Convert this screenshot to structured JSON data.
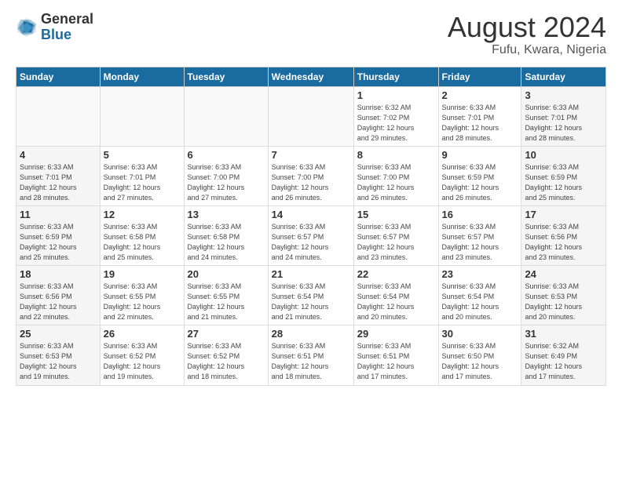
{
  "logo": {
    "general": "General",
    "blue": "Blue"
  },
  "header": {
    "month": "August 2024",
    "location": "Fufu, Kwara, Nigeria"
  },
  "weekdays": [
    "Sunday",
    "Monday",
    "Tuesday",
    "Wednesday",
    "Thursday",
    "Friday",
    "Saturday"
  ],
  "weeks": [
    [
      {
        "day": "",
        "info": ""
      },
      {
        "day": "",
        "info": ""
      },
      {
        "day": "",
        "info": ""
      },
      {
        "day": "",
        "info": ""
      },
      {
        "day": "1",
        "info": "Sunrise: 6:32 AM\nSunset: 7:02 PM\nDaylight: 12 hours\nand 29 minutes."
      },
      {
        "day": "2",
        "info": "Sunrise: 6:33 AM\nSunset: 7:01 PM\nDaylight: 12 hours\nand 28 minutes."
      },
      {
        "day": "3",
        "info": "Sunrise: 6:33 AM\nSunset: 7:01 PM\nDaylight: 12 hours\nand 28 minutes."
      }
    ],
    [
      {
        "day": "4",
        "info": "Sunrise: 6:33 AM\nSunset: 7:01 PM\nDaylight: 12 hours\nand 28 minutes."
      },
      {
        "day": "5",
        "info": "Sunrise: 6:33 AM\nSunset: 7:01 PM\nDaylight: 12 hours\nand 27 minutes."
      },
      {
        "day": "6",
        "info": "Sunrise: 6:33 AM\nSunset: 7:00 PM\nDaylight: 12 hours\nand 27 minutes."
      },
      {
        "day": "7",
        "info": "Sunrise: 6:33 AM\nSunset: 7:00 PM\nDaylight: 12 hours\nand 26 minutes."
      },
      {
        "day": "8",
        "info": "Sunrise: 6:33 AM\nSunset: 7:00 PM\nDaylight: 12 hours\nand 26 minutes."
      },
      {
        "day": "9",
        "info": "Sunrise: 6:33 AM\nSunset: 6:59 PM\nDaylight: 12 hours\nand 26 minutes."
      },
      {
        "day": "10",
        "info": "Sunrise: 6:33 AM\nSunset: 6:59 PM\nDaylight: 12 hours\nand 25 minutes."
      }
    ],
    [
      {
        "day": "11",
        "info": "Sunrise: 6:33 AM\nSunset: 6:59 PM\nDaylight: 12 hours\nand 25 minutes."
      },
      {
        "day": "12",
        "info": "Sunrise: 6:33 AM\nSunset: 6:58 PM\nDaylight: 12 hours\nand 25 minutes."
      },
      {
        "day": "13",
        "info": "Sunrise: 6:33 AM\nSunset: 6:58 PM\nDaylight: 12 hours\nand 24 minutes."
      },
      {
        "day": "14",
        "info": "Sunrise: 6:33 AM\nSunset: 6:57 PM\nDaylight: 12 hours\nand 24 minutes."
      },
      {
        "day": "15",
        "info": "Sunrise: 6:33 AM\nSunset: 6:57 PM\nDaylight: 12 hours\nand 23 minutes."
      },
      {
        "day": "16",
        "info": "Sunrise: 6:33 AM\nSunset: 6:57 PM\nDaylight: 12 hours\nand 23 minutes."
      },
      {
        "day": "17",
        "info": "Sunrise: 6:33 AM\nSunset: 6:56 PM\nDaylight: 12 hours\nand 23 minutes."
      }
    ],
    [
      {
        "day": "18",
        "info": "Sunrise: 6:33 AM\nSunset: 6:56 PM\nDaylight: 12 hours\nand 22 minutes."
      },
      {
        "day": "19",
        "info": "Sunrise: 6:33 AM\nSunset: 6:55 PM\nDaylight: 12 hours\nand 22 minutes."
      },
      {
        "day": "20",
        "info": "Sunrise: 6:33 AM\nSunset: 6:55 PM\nDaylight: 12 hours\nand 21 minutes."
      },
      {
        "day": "21",
        "info": "Sunrise: 6:33 AM\nSunset: 6:54 PM\nDaylight: 12 hours\nand 21 minutes."
      },
      {
        "day": "22",
        "info": "Sunrise: 6:33 AM\nSunset: 6:54 PM\nDaylight: 12 hours\nand 20 minutes."
      },
      {
        "day": "23",
        "info": "Sunrise: 6:33 AM\nSunset: 6:54 PM\nDaylight: 12 hours\nand 20 minutes."
      },
      {
        "day": "24",
        "info": "Sunrise: 6:33 AM\nSunset: 6:53 PM\nDaylight: 12 hours\nand 20 minutes."
      }
    ],
    [
      {
        "day": "25",
        "info": "Sunrise: 6:33 AM\nSunset: 6:53 PM\nDaylight: 12 hours\nand 19 minutes."
      },
      {
        "day": "26",
        "info": "Sunrise: 6:33 AM\nSunset: 6:52 PM\nDaylight: 12 hours\nand 19 minutes."
      },
      {
        "day": "27",
        "info": "Sunrise: 6:33 AM\nSunset: 6:52 PM\nDaylight: 12 hours\nand 18 minutes."
      },
      {
        "day": "28",
        "info": "Sunrise: 6:33 AM\nSunset: 6:51 PM\nDaylight: 12 hours\nand 18 minutes."
      },
      {
        "day": "29",
        "info": "Sunrise: 6:33 AM\nSunset: 6:51 PM\nDaylight: 12 hours\nand 17 minutes."
      },
      {
        "day": "30",
        "info": "Sunrise: 6:33 AM\nSunset: 6:50 PM\nDaylight: 12 hours\nand 17 minutes."
      },
      {
        "day": "31",
        "info": "Sunrise: 6:32 AM\nSunset: 6:49 PM\nDaylight: 12 hours\nand 17 minutes."
      }
    ]
  ]
}
